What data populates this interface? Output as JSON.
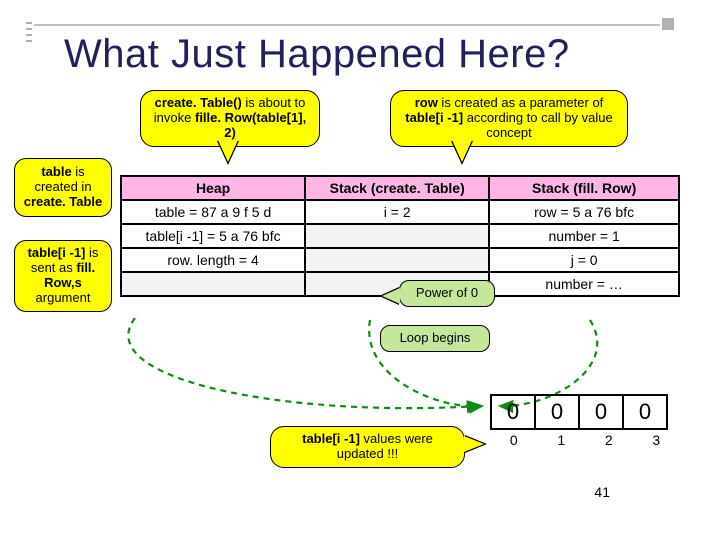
{
  "title": "What Just Happened Here?",
  "callouts": {
    "left1": {
      "b1": "table",
      "t1": " is created in ",
      "b2": "create. Table"
    },
    "left2": {
      "b1": "table[i -1]",
      "t1": " is sent as ",
      "b2": "fill. Row,s",
      "t2": " argument"
    },
    "top1": {
      "b1": "create. Table()",
      "t1": " is about to invoke ",
      "b2": "fille. Row(table[1], 2)"
    },
    "top2": {
      "b1": "row",
      "t1": " is created as a parameter of ",
      "b2": "table[i -1]",
      "t2": " according to call by value concept"
    },
    "mid1": "Power of 0",
    "mid2": "Loop begins",
    "bottom": {
      "b1": "table[i -1]",
      "t1": " values were updated !!!"
    }
  },
  "mem": {
    "headers": [
      "Heap",
      "Stack (create. Table)",
      "Stack (fill. Row)"
    ],
    "rows": [
      [
        "table = 87 a 9 f 5 d",
        "i = 2",
        "row = 5 a 76 bfc"
      ],
      [
        "table[i -1] = 5 a 76 bfc",
        "",
        "number = 1"
      ],
      [
        "row. length = 4",
        "",
        "j = 0"
      ],
      [
        "",
        "",
        "number = …"
      ]
    ]
  },
  "valtable": [
    "0",
    "0",
    "0",
    "0"
  ],
  "indices": [
    "0",
    "1",
    "2",
    "3"
  ],
  "pagenum": "41"
}
